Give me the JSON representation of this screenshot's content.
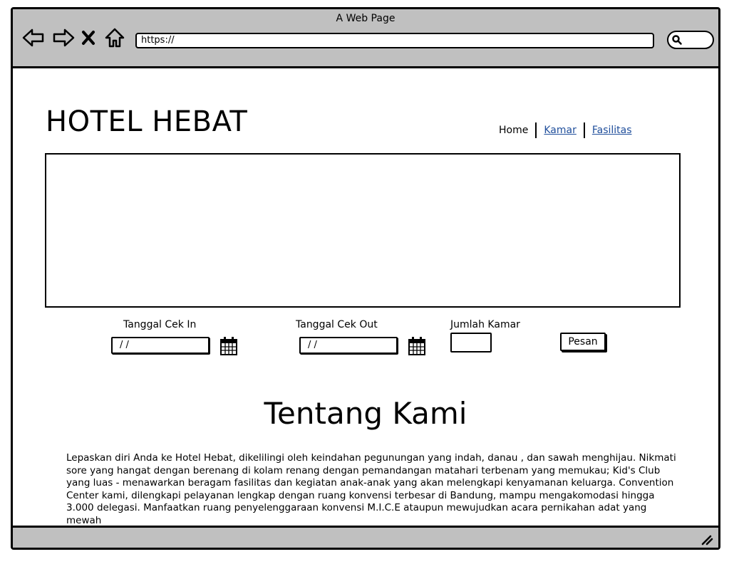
{
  "window": {
    "title": "A Web Page",
    "url": "https://"
  },
  "icons": {
    "back": "back-arrow-icon",
    "forward": "forward-arrow-icon",
    "close": "close-icon",
    "home": "home-icon",
    "search": "search-icon",
    "calendar": "calendar-icon",
    "resize": "resize-grip-icon"
  },
  "header": {
    "title": "HOTEL HEBAT",
    "nav": {
      "home": "Home",
      "kamar": "Kamar",
      "fasilitas": "Fasilitas"
    }
  },
  "booking": {
    "checkin_label": "Tanggal Cek In",
    "checkin_value": " /  /",
    "checkout_label": "Tanggal Cek Out",
    "checkout_value": " /  /",
    "rooms_label": "Jumlah Kamar",
    "submit_label": "Pesan"
  },
  "about": {
    "title": "Tentang Kami",
    "text": "Lepaskan diri Anda ke Hotel Hebat, dikelilingi oleh keindahan pegunungan yang indah, danau , dan sawah menghijau. Nikmati sore yang hangat dengan berenang di kolam renang  dengan pemandangan matahari terbenam yang memukau; Kid's Club yang luas - menawarkan beragam fasilitas dan kegiatan anak-anak yang akan melengkapi kenyamanan keluarga. Convention Center kami, dilengkapi pelayanan lengkap dengan ruang konvensi terbesar di Bandung, mampu mengakomodasi hingga 3.000 delegasi. Manfaatkan ruang penyelenggaraan konvensi M.I.C.E ataupun mewujudkan acara pernikahan adat yang mewah"
  },
  "colors": {
    "chrome": "#c0c0c0",
    "link": "#1f4e9b"
  }
}
